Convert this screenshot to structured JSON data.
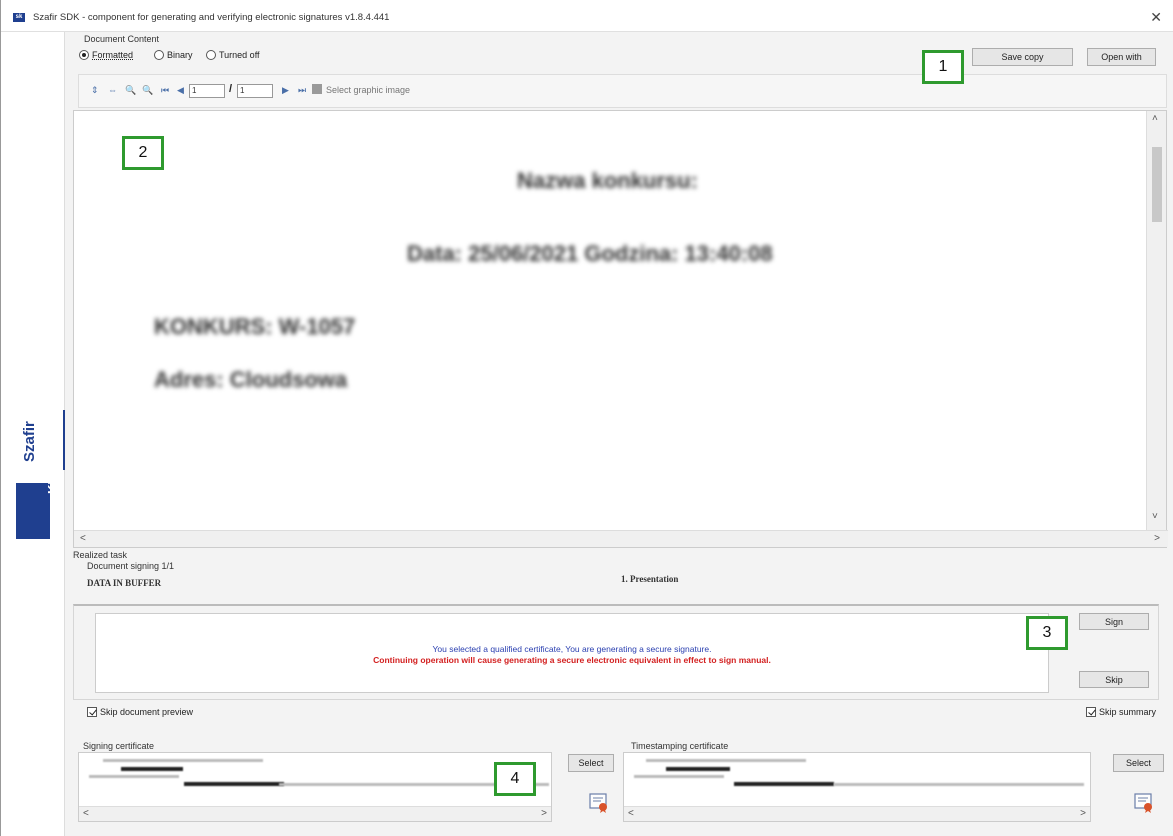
{
  "window": {
    "title": "Szafir SDK - component for generating and verifying electronic signatures  v1.8.4.441",
    "app_icon_text": "sk",
    "close_symbol": "✕"
  },
  "sidebar": {
    "brand_name": "Szafir",
    "brand_logo": "KIR."
  },
  "document_content": {
    "group_label": "Document Content",
    "modes": [
      {
        "label": "Formatted",
        "selected": true
      },
      {
        "label": "Binary",
        "selected": false
      },
      {
        "label": "Turned off",
        "selected": false
      }
    ],
    "save_copy_label": "Save copy",
    "open_with_label": "Open with"
  },
  "toolbar": {
    "icons": [
      "fit-height-icon",
      "fit-width-icon",
      "zoom-in-icon",
      "zoom-out-icon",
      "first-page-icon",
      "prev-page-icon"
    ],
    "current_page": "1",
    "page_separator": "/",
    "total_pages": "1",
    "select_graphic_label": "Select graphic image"
  },
  "preview": {
    "lines": [
      "Nazwa konkursu:",
      "Data: 25/06/2021 Godzina: 13:40:08",
      "KONKURS: W-1057",
      "Adres: Cloudsowa"
    ]
  },
  "task": {
    "realized_task_label": "Realized task",
    "signing_progress": "Document signing 1/1",
    "status": "DATA IN BUFFER",
    "step": "1. Presentation",
    "message_info": "You selected a qualified certificate, You are generating a secure signature.",
    "message_warning": "Continuing operation will cause generating a secure electronic equivalent in effect to sign manual.",
    "sign_label": "Sign",
    "skip_label": "Skip"
  },
  "options": {
    "skip_preview_label": "Skip document preview",
    "skip_preview_checked": true,
    "skip_summary_label": "Skip summary",
    "skip_summary_checked": true
  },
  "certificates": {
    "signing_label": "Signing certificate",
    "timestamping_label": "Timestamping certificate",
    "select_label": "Select"
  },
  "markers": [
    "1",
    "2",
    "3",
    "4"
  ],
  "colors": {
    "brand": "#1f3f8f",
    "marker_border": "#2e9a2e",
    "info_text": "#2a3fb0",
    "warning_text": "#d32020"
  }
}
